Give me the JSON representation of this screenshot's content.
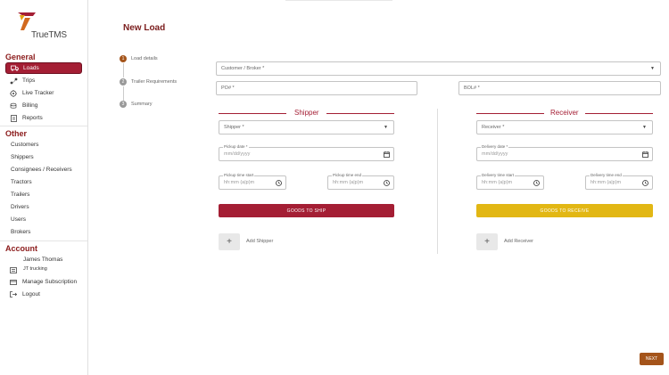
{
  "app": {
    "logo_text": "TrueTMS",
    "colors": {
      "brand": "#a41e34",
      "accent": "#e2b714",
      "step_active": "#a4541a"
    }
  },
  "sidebar": {
    "general_title": "General",
    "general_items": [
      {
        "label": "Loads",
        "icon": "truck-icon",
        "active": true
      },
      {
        "label": "Trips",
        "icon": "route-icon"
      },
      {
        "label": "Live Tracker",
        "icon": "location-icon"
      },
      {
        "label": "Billing",
        "icon": "billing-icon"
      },
      {
        "label": "Reports",
        "icon": "report-icon"
      }
    ],
    "other_title": "Other",
    "other_items": [
      "Customers",
      "Shippers",
      "Consignees / Receivers",
      "Tractors",
      "Trailers",
      "Drivers",
      "Users",
      "Brokers"
    ],
    "account_title": "Account",
    "account_user_name": "James Thomas",
    "account_company": "JT trucking",
    "account_items": [
      {
        "label": "Manage Subscription",
        "icon": "card-icon"
      },
      {
        "label": "Logout",
        "icon": "logout-icon"
      }
    ]
  },
  "main": {
    "title": "New Load",
    "steps": [
      {
        "num": "1",
        "label": "Load details"
      },
      {
        "num": "2",
        "label": "Trailer Requirements"
      },
      {
        "num": "3",
        "label": "Summary"
      }
    ],
    "customer_placeholder": "Customer / Broker *",
    "po_placeholder": "PO# *",
    "bol_placeholder": "BOL# *",
    "shipper": {
      "heading": "Shipper",
      "select_placeholder": "Shipper *",
      "date_label": "Pickup date *",
      "date_placeholder": "mm/dd/yyyy",
      "start_label": "Pickup time start",
      "end_label": "Pickup time end",
      "time_placeholder": "hh:mm (a|p)m",
      "goods_button": "GOODS TO SHIP",
      "add_label": "Add Shipper"
    },
    "receiver": {
      "heading": "Receiver",
      "select_placeholder": "Receiver *",
      "date_label": "Delivery date *",
      "date_placeholder": "mm/dd/yyyy",
      "start_label": "Delivery time start",
      "end_label": "Delivery time end",
      "time_placeholder": "hh:mm (a|p)m",
      "goods_button": "GOODS TO RECEIVE",
      "add_label": "Add Receiver"
    },
    "add_symbol": "+",
    "next_button": "NEXT"
  }
}
